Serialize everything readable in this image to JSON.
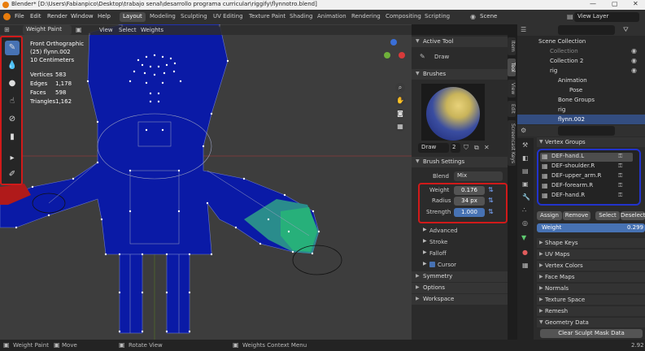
{
  "window": {
    "title": "Blender* [D:\\Users\\Fabianpico\\Desktop\\trabajo senal\\desarrollo programa curricular\\riggify\\flynnotro.blend]",
    "controls": [
      "—",
      "▢",
      "✕"
    ]
  },
  "menu": [
    "File",
    "Edit",
    "Render",
    "Window",
    "Help"
  ],
  "workspaces": [
    "Layout",
    "Modeling",
    "Sculpting",
    "UV Editing",
    "Texture Paint",
    "Shading",
    "Animation",
    "Rendering",
    "Compositing",
    "Scripting"
  ],
  "scene": "Scene",
  "view_layer": "View Layer",
  "viewport": {
    "mode": "Weight Paint",
    "menus": [
      "View",
      "Select",
      "Weights"
    ],
    "overlay_title": "Front Orthographic",
    "overlay_object": "(25) flynn.002",
    "overlay_scale": "10 Centimeters",
    "stats": [
      {
        "label": "Vertices",
        "value": "583"
      },
      {
        "label": "Edges",
        "value": "1,178"
      },
      {
        "label": "Faces",
        "value": "598"
      },
      {
        "label": "Triangles",
        "value": "1,162"
      }
    ]
  },
  "npanel": {
    "active_tool_header": "Active Tool",
    "tool_name": "Draw",
    "brushes_header": "Brushes",
    "brush_name": "Draw",
    "brush_users": "2",
    "brush_settings_header": "Brush Settings",
    "blend_label": "Blend",
    "blend_value": "Mix",
    "weight_label": "Weight",
    "weight_value": "0.176",
    "radius_label": "Radius",
    "radius_value": "34 px",
    "strength_label": "Strength",
    "strength_value": "1.000",
    "subsections": [
      "Advanced",
      "Stroke",
      "Falloff",
      "Cursor"
    ],
    "sections": [
      "Symmetry",
      "Options",
      "Workspace"
    ]
  },
  "side_tabs": [
    "Item",
    "Tool",
    "View",
    "Edit",
    "Screencast Keys"
  ],
  "outliner": {
    "items": [
      {
        "label": "Scene Collection"
      },
      {
        "label": "Collection"
      },
      {
        "label": "Collection 2"
      },
      {
        "label": "rig"
      },
      {
        "label": "Animation"
      },
      {
        "label": "Pose"
      },
      {
        "label": "Bone Groups"
      },
      {
        "label": "rig"
      },
      {
        "label": "flynn.002"
      }
    ]
  },
  "properties": {
    "vertex_groups_header": "Vertex Groups",
    "groups": [
      "DEF-hand.L",
      "DEF-shoulder.R",
      "DEF-upper_arm.R",
      "DEF-forearm.R",
      "DEF-hand.R"
    ],
    "buttons": [
      "Assign",
      "Remove",
      "Select",
      "Deselect"
    ],
    "weight_label": "Weight",
    "weight_value": "0.299",
    "sections": [
      "Shape Keys",
      "UV Maps",
      "Vertex Colors",
      "Face Maps",
      "Normals",
      "Texture Space",
      "Remesh",
      "Geometry Data"
    ],
    "clear_button": "Clear Sculpt Mask Data"
  },
  "statusbar": {
    "left": "Weight Paint",
    "move": "Move",
    "rotate": "Rotate View",
    "context": "Weights Context Menu",
    "version": "2.92"
  },
  "colors": {
    "accent": "#4772b3",
    "highlight_red": "#d11a1a",
    "highlight_blue": "#2233cc",
    "mesh_blue": "#0a1aa6"
  }
}
